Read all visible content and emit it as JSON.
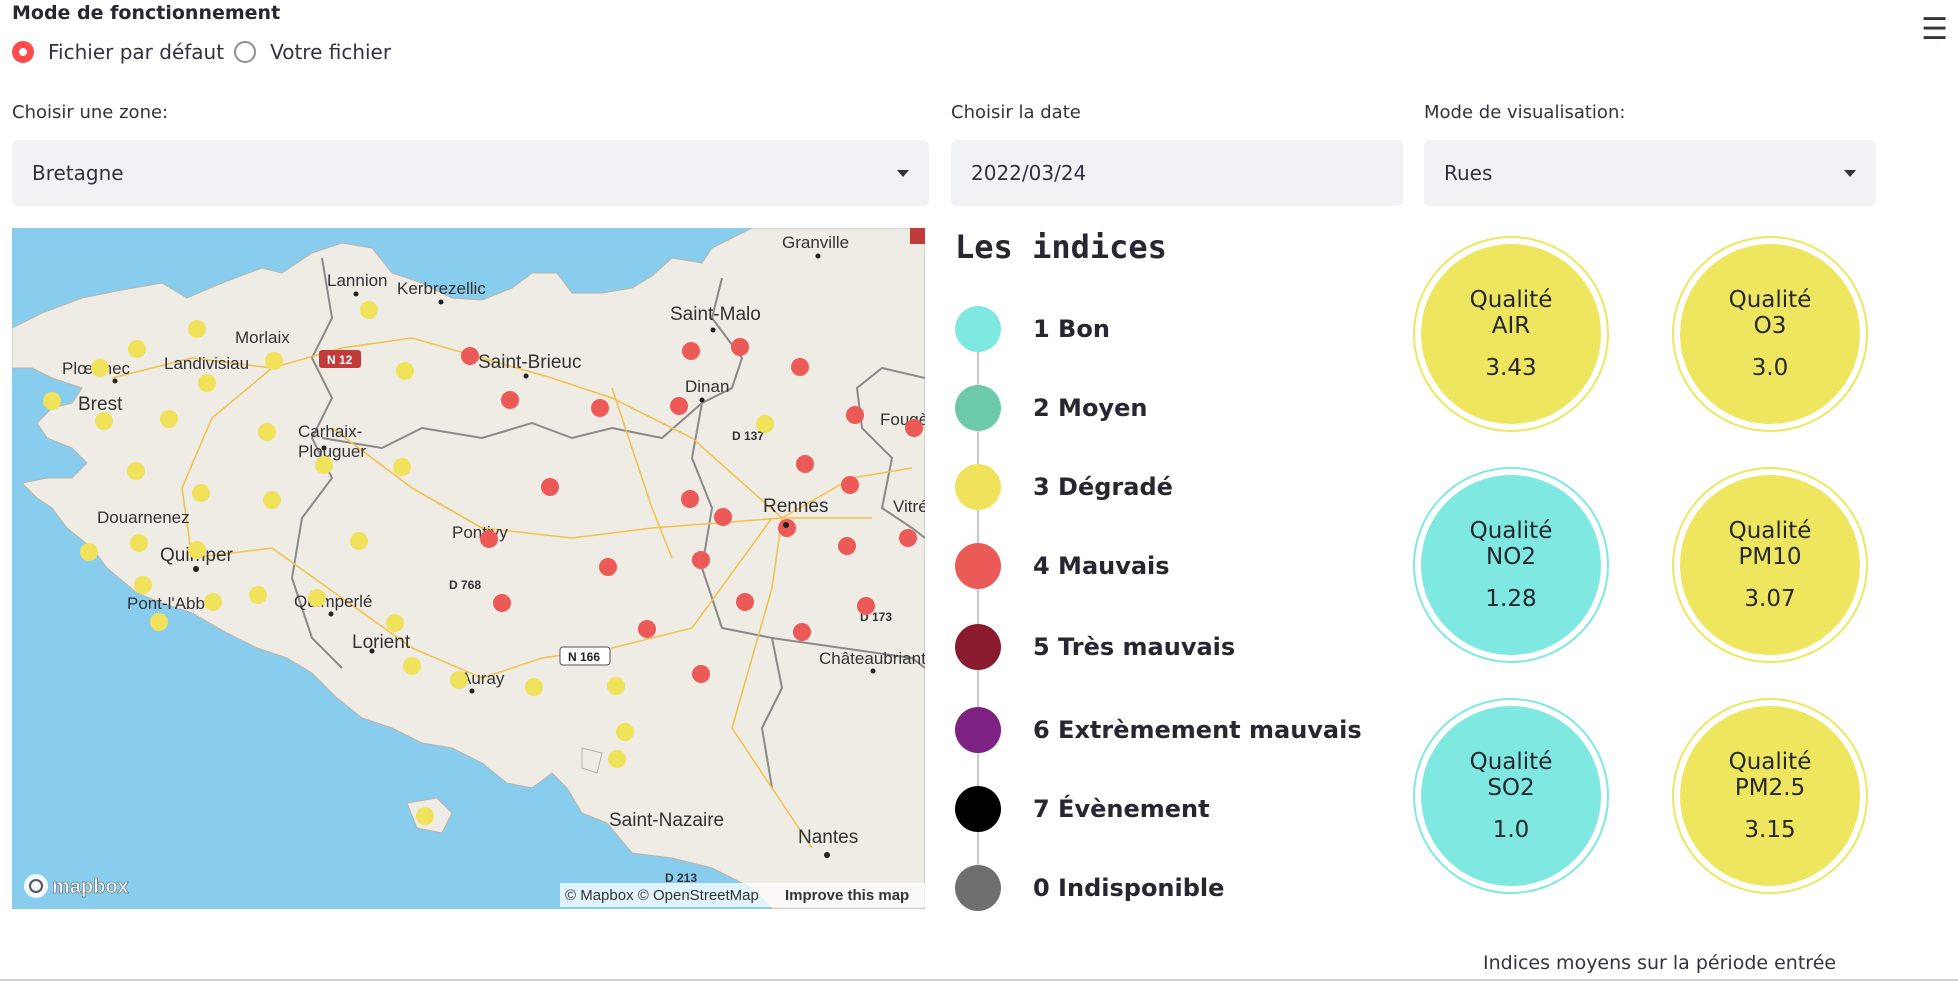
{
  "mode": {
    "title": "Mode de fonctionnement",
    "options": [
      {
        "label": "Fichier par défaut",
        "selected": true
      },
      {
        "label": "Votre fichier",
        "selected": false
      }
    ]
  },
  "menu_icon": "hamburger-icon",
  "zone": {
    "label": "Choisir une zone:",
    "value": "Bretagne"
  },
  "date": {
    "label": "Choisir la date",
    "value": "2022/03/24"
  },
  "visualisation": {
    "label": "Mode de visualisation:",
    "value": "Rues"
  },
  "map": {
    "labels": {
      "granville": "Granville",
      "lannion": "Lannion",
      "kerbrezellic": "Kerbrezellic",
      "saint_malo": "Saint-Malo",
      "morlaix": "Morlaix",
      "n12": "N 12",
      "saint_brieuc": "Saint-Brieuc",
      "ploennec": "Plœnnec",
      "landivisiau": "Landivisiau",
      "brest": "Brest",
      "dinan": "Dinan",
      "fougeres": "Fougè",
      "carhaix": "Carhaix-",
      "plouguer": "Plouguer",
      "d137": "D 137",
      "rennes": "Rennes",
      "vitre": "Vitré",
      "douarnenez": "Douarnenez",
      "pontivy": "Pontivy",
      "quimper": "Quimper",
      "d768": "D 768",
      "pont_labbe": "Pont-l'Abbé",
      "quimperle": "Quimperlé",
      "d173": "D 173",
      "lorient": "Lorient",
      "n166": "N 166",
      "chateaubriant": "Châteaubriant",
      "auray": "Auray",
      "saint_nazaire": "Saint-Nazaire",
      "nantes": "Nantes",
      "d213": "D 213",
      "mapbox_logo": "mapbox",
      "attribution": "© Mapbox © OpenStreetMap",
      "improve": "Improve this map"
    }
  },
  "legend": {
    "title": "Les indices",
    "items": [
      {
        "label": "1 Bon",
        "color": "#7ee8e1"
      },
      {
        "label": "2 Moyen",
        "color": "#6cc9a9"
      },
      {
        "label": "3 Dégradé",
        "color": "#f0e25a"
      },
      {
        "label": "4 Mauvais",
        "color": "#ec5a58"
      },
      {
        "label": "5 Très mauvais",
        "color": "#8a1a2e"
      },
      {
        "label": "6 Extrèmement mauvais",
        "color": "#7d2183"
      },
      {
        "label": "7 Évènement",
        "color": "#000000"
      },
      {
        "label": "0 Indisponible",
        "color": "#6f6f6f"
      }
    ]
  },
  "qualities": [
    {
      "line1": "Qualité",
      "line2": "AIR",
      "value": "3.43",
      "color": "#eee65e"
    },
    {
      "line1": "Qualité",
      "line2": "O3",
      "value": "3.0",
      "color": "#eee65e"
    },
    {
      "line1": "Qualité",
      "line2": "NO2",
      "value": "1.28",
      "color": "#7ee8e1"
    },
    {
      "line1": "Qualité",
      "line2": "PM10",
      "value": "3.07",
      "color": "#eee65e"
    },
    {
      "line1": "Qualité",
      "line2": "SO2",
      "value": "1.0",
      "color": "#7ee8e1"
    },
    {
      "line1": "Qualité",
      "line2": "PM2.5",
      "value": "3.15",
      "color": "#eee65e"
    }
  ],
  "footer": "Indices moyens sur la période entrée",
  "colors": {
    "accent": "#ff4b4b",
    "input_bg": "#f0f2f6",
    "sea": "#88cdee",
    "land": "#efebe5",
    "yellow_marker": "#f0e25a",
    "red_marker": "#ec5a58"
  }
}
